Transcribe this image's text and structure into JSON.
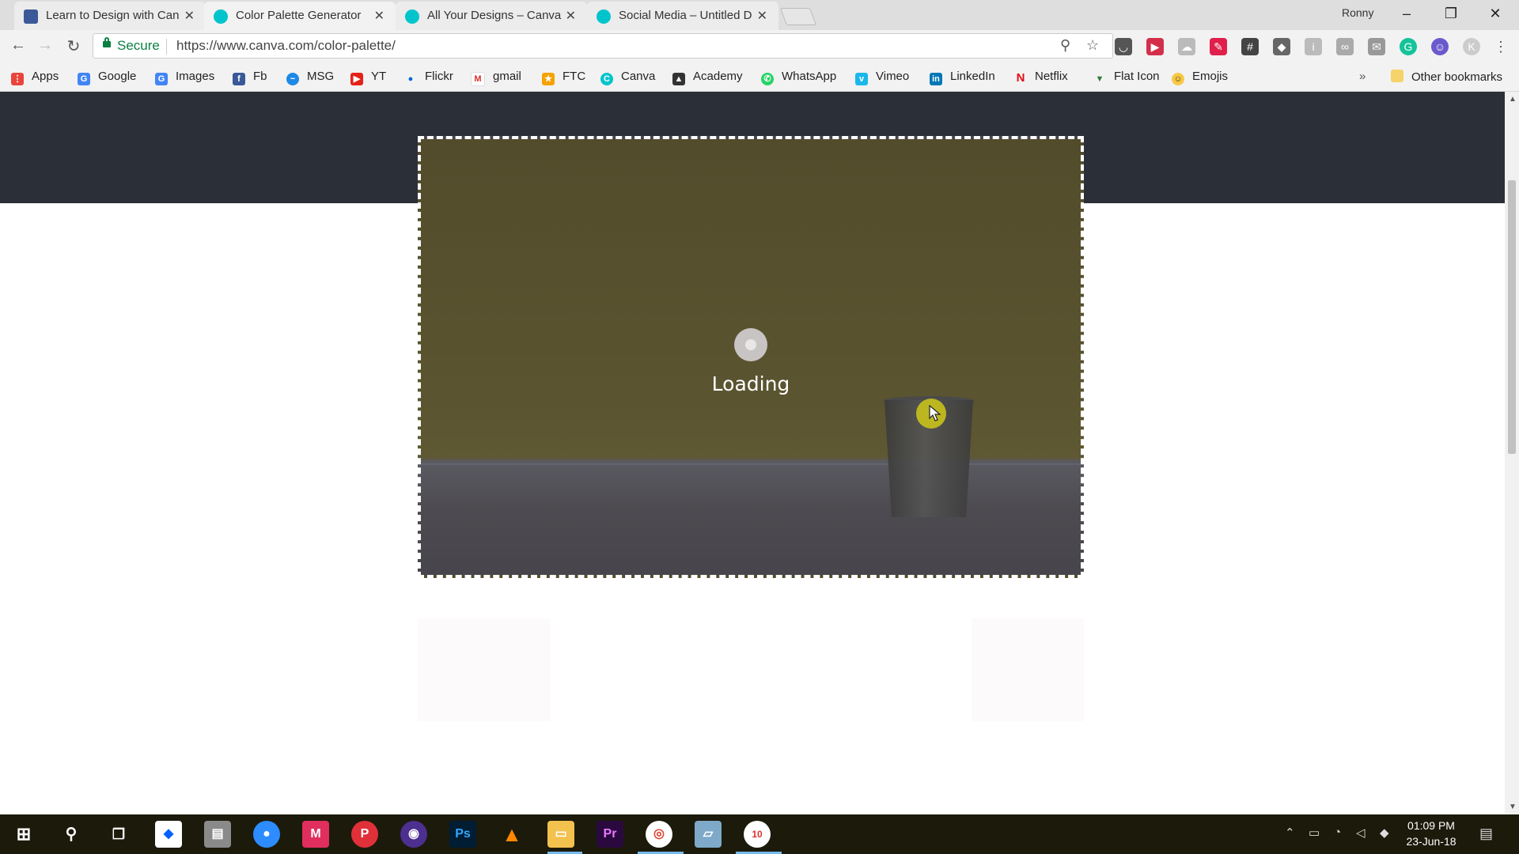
{
  "browser": {
    "profile_name": "Ronny",
    "tabs": [
      {
        "title": "Learn to Design with Can",
        "favicon": "facebook-icon"
      },
      {
        "title": "Color Palette Generator",
        "favicon": "canva-icon",
        "active": true
      },
      {
        "title": "All Your Designs – Canva",
        "favicon": "canva-icon"
      },
      {
        "title": "Social Media – Untitled D",
        "favicon": "canva-icon"
      }
    ],
    "address": {
      "secure_label": "Secure",
      "url": "https://www.canva.com/color-palette/"
    },
    "bookmarks": [
      {
        "label": "Apps",
        "icon": "apps-grid-icon"
      },
      {
        "label": "Google",
        "icon": "google-icon"
      },
      {
        "label": "Images",
        "icon": "google-icon"
      },
      {
        "label": "Fb",
        "icon": "facebook-icon"
      },
      {
        "label": "MSG",
        "icon": "messenger-icon"
      },
      {
        "label": "YT",
        "icon": "youtube-icon"
      },
      {
        "label": "Flickr",
        "icon": "flickr-icon"
      },
      {
        "label": "gmail",
        "icon": "gmail-icon"
      },
      {
        "label": "FTC",
        "icon": "ftc-icon"
      },
      {
        "label": "Canva",
        "icon": "canva-icon"
      },
      {
        "label": "Academy",
        "icon": "academy-icon"
      },
      {
        "label": "WhatsApp",
        "icon": "whatsapp-icon"
      },
      {
        "label": "Vimeo",
        "icon": "vimeo-icon"
      },
      {
        "label": "LinkedIn",
        "icon": "linkedin-icon"
      },
      {
        "label": "Netflix",
        "icon": "netflix-icon"
      },
      {
        "label": "Flat Icon",
        "icon": "flaticon-icon"
      },
      {
        "label": "Emojis",
        "icon": "emoji-icon"
      }
    ],
    "overflow_label": "»",
    "other_bookmarks_label": "Other bookmarks"
  },
  "page": {
    "loading_text": "Loading"
  },
  "taskbar": {
    "time": "01:09 PM",
    "date": "23-Jun-18",
    "badge_count": "10"
  }
}
